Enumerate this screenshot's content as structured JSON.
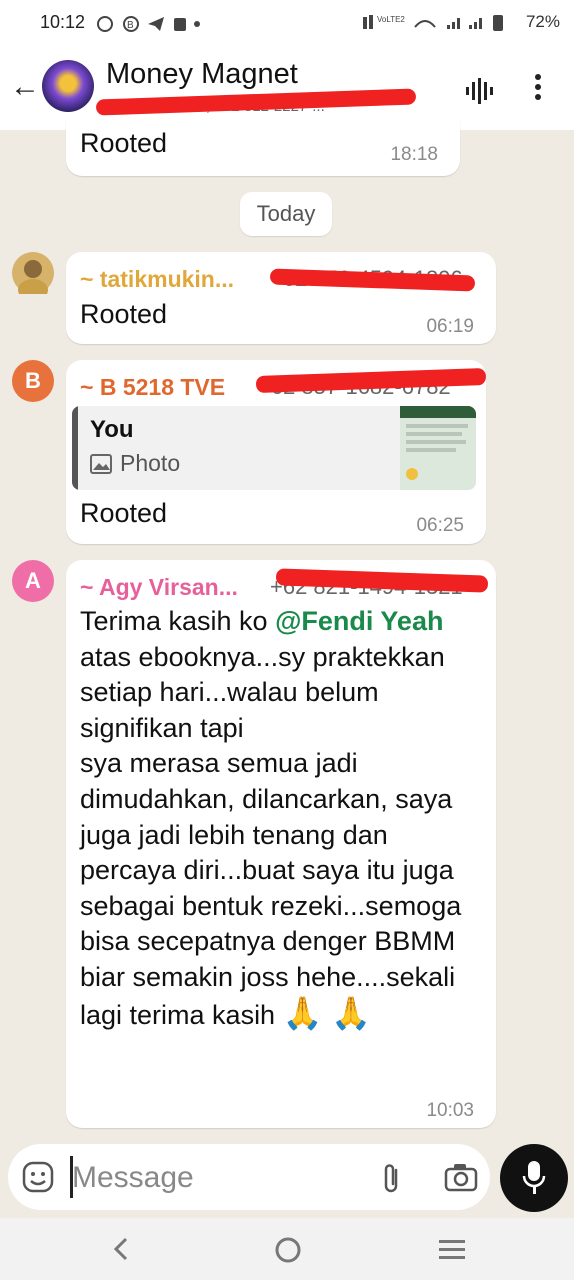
{
  "status_bar": {
    "time": "10:12",
    "left_icons": [
      "whatsapp-icon",
      "b-badge-icon",
      "telegram-icon",
      "shop-icon",
      "dot-icon"
    ],
    "network_label": "VoLTE2",
    "battery": "72%"
  },
  "header": {
    "title": "Money Magnet",
    "subtitle": "+62 811-811-..., +62 812-2227-...",
    "back_icon": "back-arrow-icon",
    "voice_icon": "voice-chat-icon",
    "menu_icon": "more-vert-icon"
  },
  "messages": {
    "prev": {
      "text": "Rooted",
      "time": "18:18"
    },
    "day_label": "Today",
    "m1": {
      "sender": "~ tatikmukin...",
      "phone": "+62 856-4594-1896",
      "text": "Rooted",
      "time": "06:19",
      "sender_color": "#e0a83a"
    },
    "m2": {
      "avatar_letter": "B",
      "sender": "~ B 5218 TVE",
      "phone": "+62 857-1682-6782",
      "quote_author": "You",
      "quote_type": "Photo",
      "text": "Rooted",
      "time": "06:25",
      "sender_color": "#e0682e"
    },
    "m3": {
      "avatar_letter": "A",
      "sender": "~ Agy Virsan...",
      "phone": "+62 821-1494-1321",
      "text_pre": "Terima kasih ko ",
      "mention": "@Fendi Yeah",
      "text_post": " atas ebooknya...sy praktekkan setiap hari...walau belum signifikan tapi\nsya merasa semua jadi dimudahkan, dilancarkan, saya juga jadi lebih tenang dan percaya diri...buat saya itu juga sebagai bentuk rezeki...semoga bisa secepatnya denger BBMM biar semakin joss hehe....sekali lagi terima kasih",
      "emoji": "🙏 🙏",
      "time": "10:03",
      "sender_color": "#e8609a"
    }
  },
  "composer": {
    "placeholder": "Message",
    "emoji_icon": "sticker-icon",
    "attach_icon": "paperclip-icon",
    "camera_icon": "camera-icon",
    "mic_icon": "mic-icon"
  },
  "nav": {
    "back": "nav-back-icon",
    "home": "nav-home-icon",
    "recents": "nav-recents-icon"
  },
  "colors": {
    "chat_bg": "#efeae2",
    "mention": "#1a8a4a",
    "redaction": "#ef2121"
  }
}
